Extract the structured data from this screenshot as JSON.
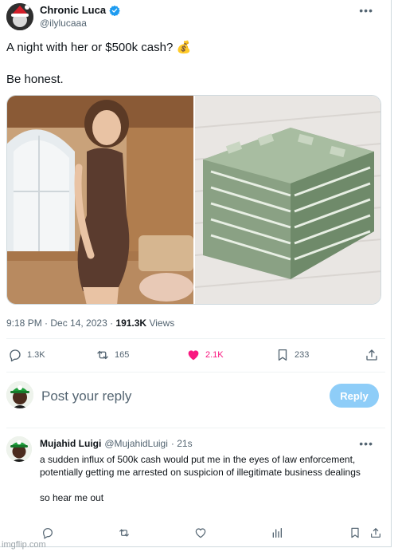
{
  "author": {
    "name": "Chronic Luca",
    "handle": "@ilylucaaa"
  },
  "tweet": {
    "line1": "A night with her or $500k cash? 💰",
    "line2": "Be honest.",
    "time": "9:18 PM · Dec 14, 2023 · ",
    "views_count": "191.3K",
    "views_label": " Views"
  },
  "actions": {
    "replies": "1.3K",
    "retweets": "165",
    "likes": "2.1K",
    "bookmarks": "233"
  },
  "composer": {
    "placeholder": "Post your reply",
    "button": "Reply"
  },
  "reply": {
    "name": "Mujahid Luigi",
    "handle": "@MujahidLuigi",
    "time": "· 21s",
    "text1": "a sudden influx of 500k cash would put me in the eyes of law enforcement, potentially getting me arrested on suspicion of  illegitimate business dealings",
    "text2": "so hear me out"
  },
  "colors": {
    "accent": "#1d9bf0",
    "like": "#f91880",
    "reply_button": "#8ecdf8",
    "muted": "#536471"
  },
  "watermark": "imgflip.com"
}
